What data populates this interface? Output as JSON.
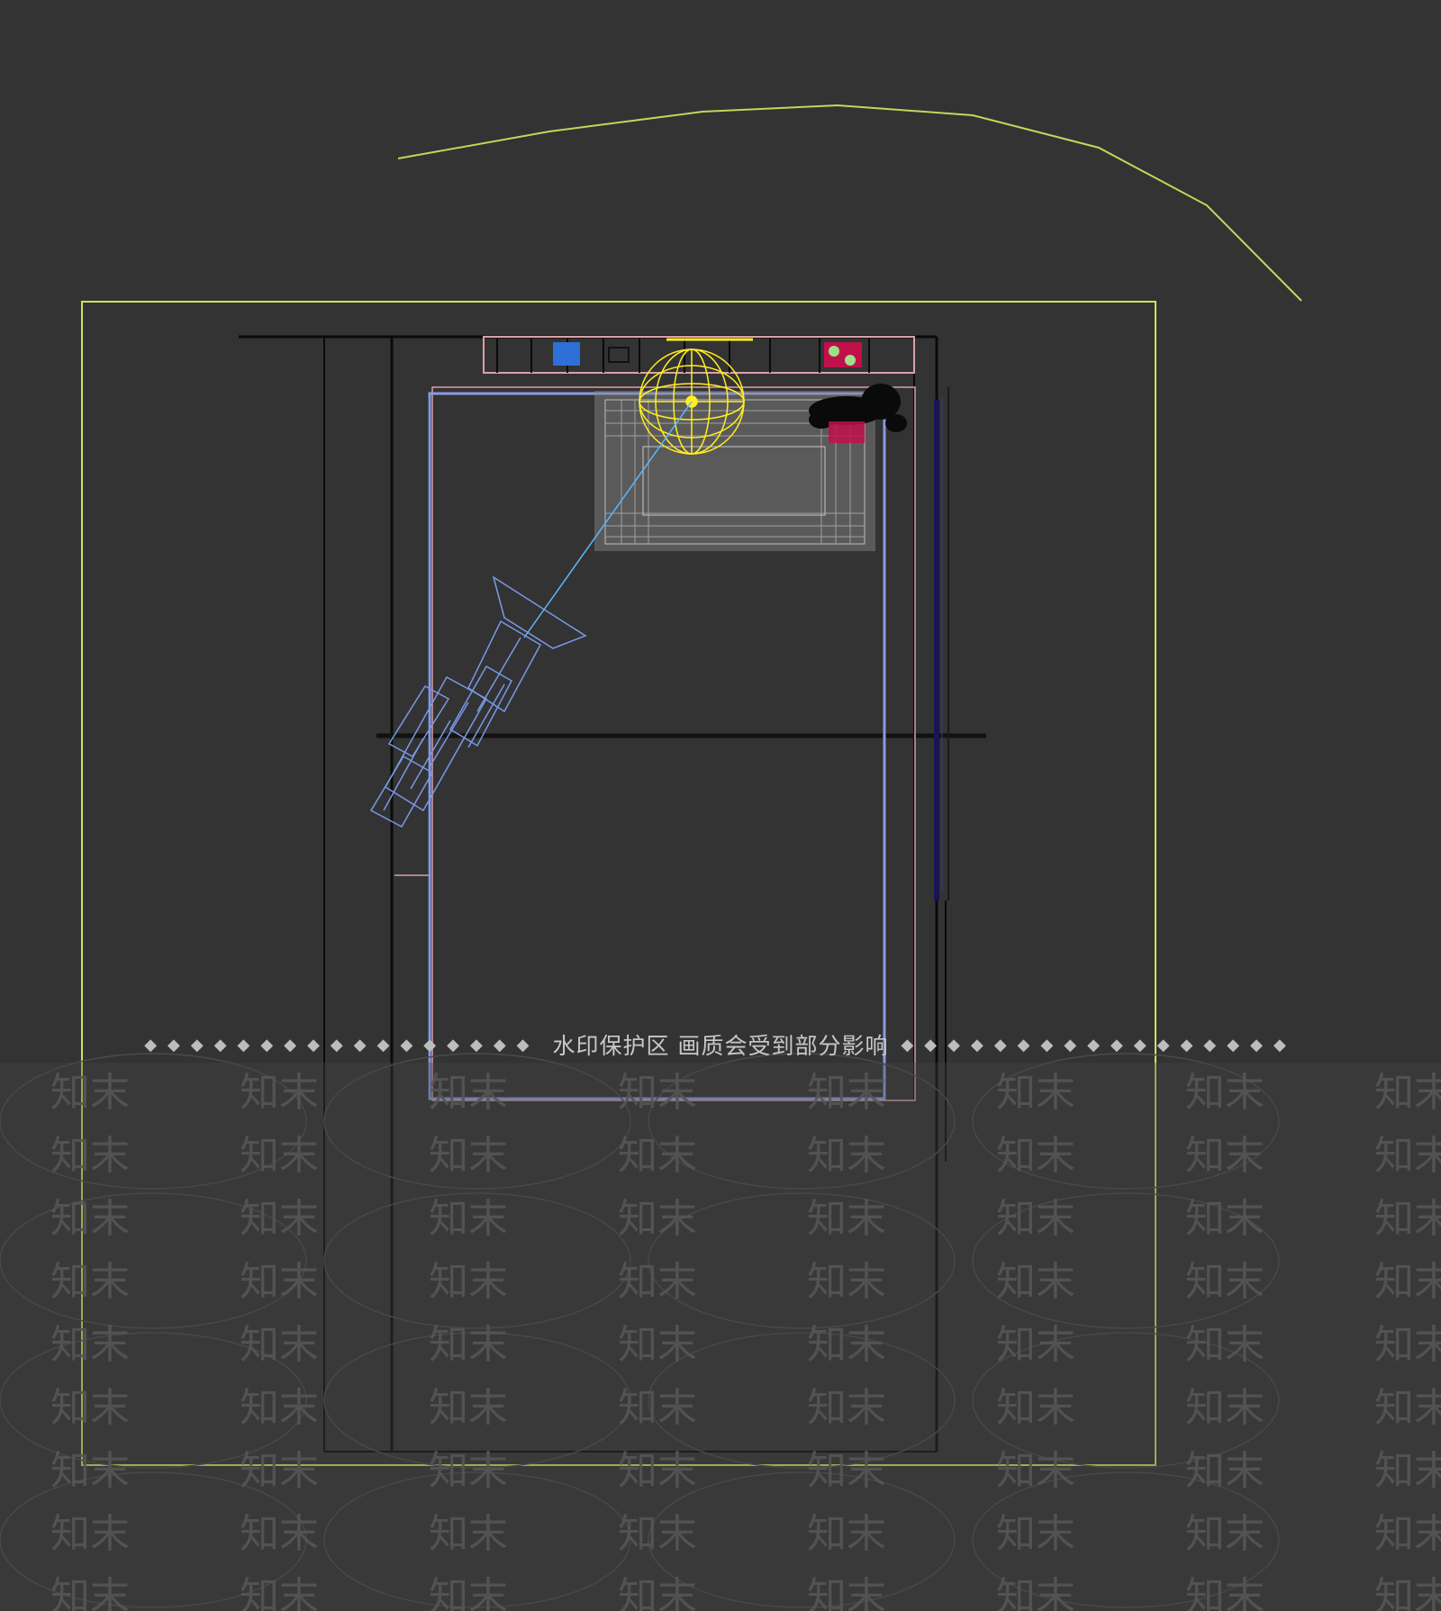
{
  "watermark": {
    "notice": "水印保护区  画质会受到部分影响",
    "brand": "知末",
    "dots": "◆◆◆◆◆◆◆◆◆◆◆◆◆◆◆◆◆"
  },
  "colors": {
    "background": "#333333",
    "safe_frame": "#d4e05a",
    "spline": "#c8d45a",
    "camera": "#7a98e8",
    "target_line": "#5ab8ff",
    "light": "#ffee22",
    "wall": "#0a0a0a",
    "rug": "#8a8a8a",
    "plant": "#0a0a0a",
    "accent_red": "#c0104a",
    "accent_blue": "#2e6fd8",
    "pink_outline": "#d9a0a8"
  },
  "icons": {
    "camera": "camera-icon",
    "light": "omni-light-icon",
    "plant": "plant-icon"
  }
}
